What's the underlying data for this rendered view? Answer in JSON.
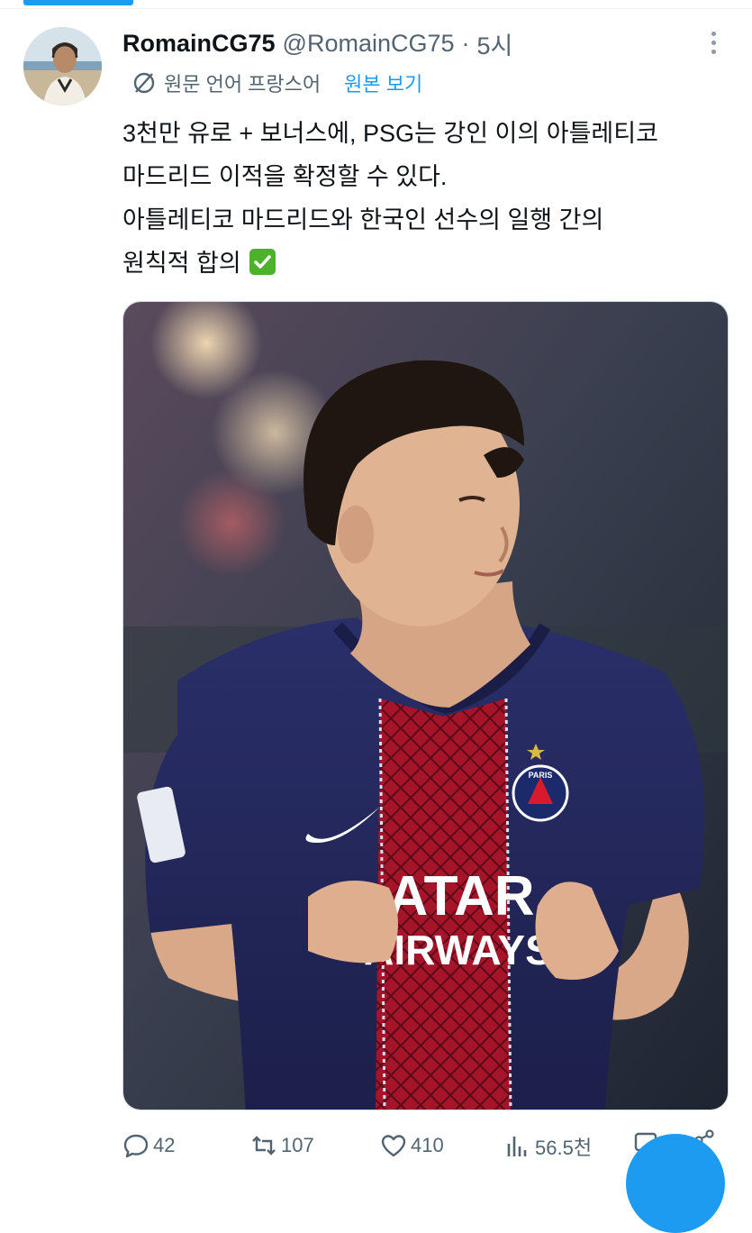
{
  "tweet": {
    "display_name": "RomainCG75",
    "handle": "@RomainCG75",
    "separator": "·",
    "time": "5시",
    "translation_note": "원문 언어 프랑스어",
    "view_original": "원본 보기",
    "text_lines": [
      "3천만 유로 + 보너스에, PSG는 강인 이의 아틀레티코",
      "마드리드 이적을 확정할 수 있다.",
      "아틀레티코 마드리드와 한국인 선수의 일행 간의",
      "원칙적 합의"
    ],
    "media_text": {
      "sponsor_line1": "ATAR",
      "sponsor_line2": "AIRWAYS",
      "crest": "PARIS"
    },
    "actions": {
      "replies": "42",
      "retweets": "107",
      "likes": "410",
      "views": "56.5천"
    }
  },
  "colors": {
    "accent": "#1d9bf0",
    "secondary_text": "#536471",
    "kit_navy": "#1f2350",
    "kit_red": "#b5152b"
  }
}
